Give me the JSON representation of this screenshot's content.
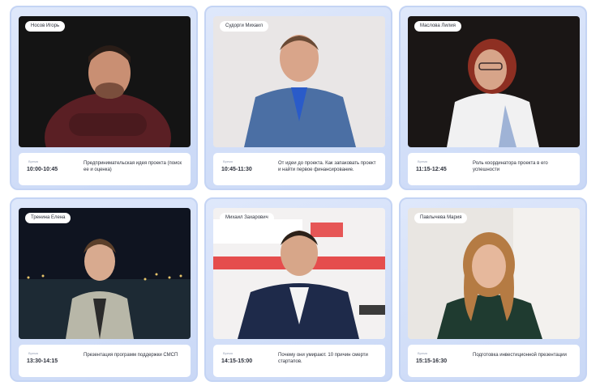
{
  "speakers": [
    {
      "name": "Носов Игорь",
      "time_label": "Время",
      "time": "10:00-10:45",
      "topic": "Предпринимательская идея проекта (поиск ее и оценка)"
    },
    {
      "name": "Судорги Михаил",
      "time_label": "Время",
      "time": "10:45-11:30",
      "topic": "От идеи до проекта. Как запаковать проект и найти первое финансирование."
    },
    {
      "name": "Маслова Лилия",
      "time_label": "Время",
      "time": "11:15-12:45",
      "topic": "Роль координатора проекта в его успешности"
    },
    {
      "name": "Тренина Елена",
      "time_label": "Время",
      "time": "13:30-14:15",
      "topic": "Презентация программ поддержки СМСП"
    },
    {
      "name": "Михаил Захарович",
      "time_label": "Время",
      "time": "14:15-15:00",
      "topic": "Почему они умирают. 10 причин смерти стартапов."
    },
    {
      "name": "Павлычева Мария",
      "time_label": "Время",
      "time": "15:15-16:30",
      "topic": "Подготовка инвестиционной презентации"
    }
  ],
  "colors": {
    "card_bg": "#cfdcf7",
    "card_border": "#c4d4f4",
    "text": "#2b2f3a"
  }
}
